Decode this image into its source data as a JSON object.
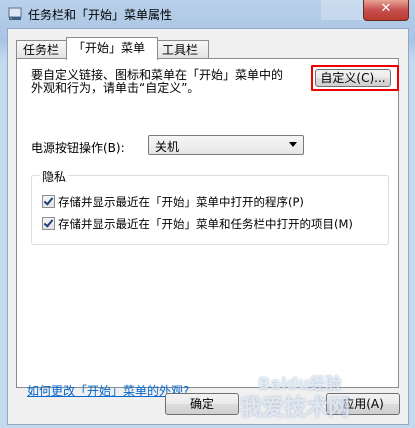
{
  "window": {
    "title": "任务栏和「开始」菜单属性",
    "close_glyph": "✕"
  },
  "tabs": [
    {
      "label": "任务栏"
    },
    {
      "label": "「开始」菜单",
      "active": true
    },
    {
      "label": "工具栏"
    }
  ],
  "start_menu": {
    "description_line1": "要自定义链接、图标和菜单在「开始」菜单中的",
    "description_line2": "外观和行为，请单击“自定义”。",
    "customize_label": "自定义(C)...",
    "power_label": "电源按钮操作(B):",
    "power_value": "关机",
    "privacy_title": "隐私",
    "check1_label": "存储并显示最近在「开始」菜单中打开的程序(P)",
    "check1_checked": true,
    "check2_label": "存储并显示最近在「开始」菜单和任务栏中打开的项目(M)",
    "check2_checked": true,
    "help_link": "如何更改「开始」菜单的外观?"
  },
  "footer": {
    "ok_label": "确定",
    "apply_label": "应用(A)"
  },
  "watermark": {
    "line1": "我爱技术网",
    "line2": "Baidu经验"
  },
  "colors": {
    "highlight_border": "#e00000",
    "link": "#0066cc"
  }
}
